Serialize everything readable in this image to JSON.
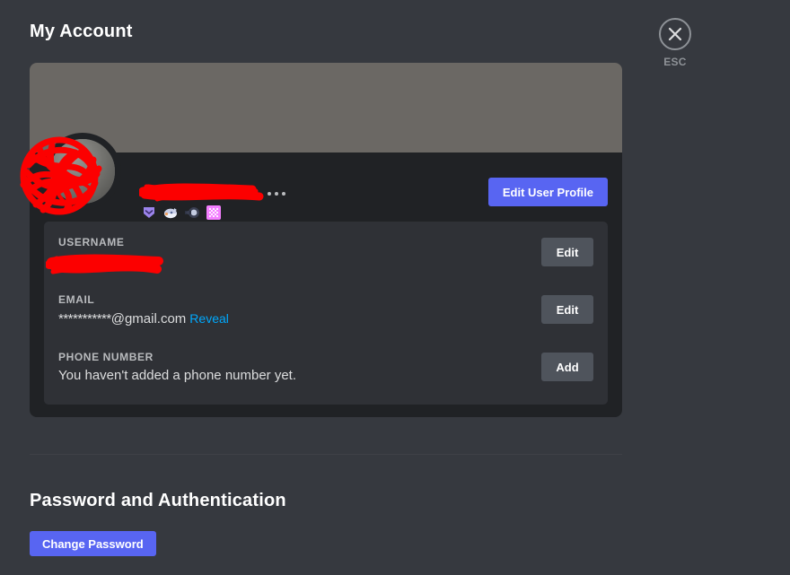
{
  "page": {
    "title": "My Account",
    "background_color": "#36393F",
    "card_color": "#202225",
    "panel_color": "#2F3136",
    "banner_color": "#6B6864",
    "accent_color": "#5865F2",
    "link_color": "#00A8FC",
    "neutral_button_color": "#4F545C"
  },
  "close": {
    "icon": "close-x-icon",
    "label": "ESC"
  },
  "profile": {
    "avatar": "user-avatar-redacted",
    "display_name": "[redacted]",
    "display_name_suffix_dots": 3,
    "edit_profile_label": "Edit User Profile",
    "badges": [
      {
        "name": "nitro-shield-badge",
        "color": "#9b84ec"
      },
      {
        "name": "early-supporter-badge",
        "color": "#f0f2fa"
      },
      {
        "name": "hypesquad-badge",
        "color": "#3a3f52"
      },
      {
        "name": "active-developer-badge",
        "color": "#f47fff"
      }
    ]
  },
  "fields": [
    {
      "label": "USERNAME",
      "value": "[redacted]",
      "redacted": true,
      "action_label": "Edit",
      "action_name": "edit-username-button"
    },
    {
      "label": "EMAIL",
      "value": "***********@gmail.com",
      "masked_part": "***********",
      "domain_part": "@gmail.com",
      "reveal_label": "Reveal",
      "redacted": false,
      "action_label": "Edit",
      "action_name": "edit-email-button"
    },
    {
      "label": "PHONE NUMBER",
      "value": "You haven't added a phone number yet.",
      "redacted": false,
      "action_label": "Add",
      "action_name": "add-phone-button"
    }
  ],
  "password_section": {
    "title": "Password and Authentication",
    "change_password_label": "Change Password"
  }
}
